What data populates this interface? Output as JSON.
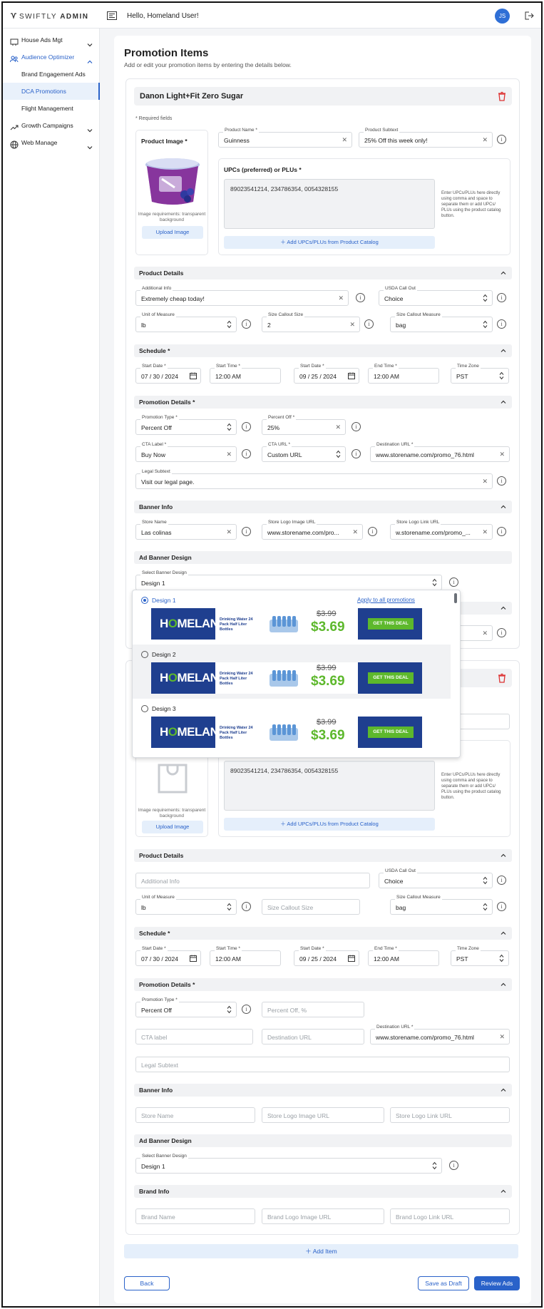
{
  "brand": {
    "name_a": "SWIFTLY",
    "name_b": "ADMIN"
  },
  "header": {
    "greeting": "Hello, Homeland User!",
    "avatar_initials": "JS"
  },
  "sidebar": {
    "items": [
      {
        "label": "House Ads Mgt"
      },
      {
        "label": "Audience Optimizer"
      },
      {
        "label": "Growth Campaigns"
      },
      {
        "label": "Web Manage"
      }
    ],
    "subitems": [
      {
        "label": "Brand Engagement Ads"
      },
      {
        "label": "DCA Promotions"
      },
      {
        "label": "Flight Management"
      }
    ]
  },
  "page": {
    "title": "Promotion Items",
    "subtitle": "Add or edit your promotion items by entering the details below."
  },
  "item1": {
    "title": "Danon Light+Fit Zero Sugar",
    "required_note": "* Required fields",
    "product_image_label": "Product Image *",
    "image_req": "Image requirements: transparent background",
    "upload_label": "Upload Image",
    "product_name": {
      "label": "Product Name *",
      "value": "Guinness"
    },
    "product_subtext": {
      "label": "Product Subtext",
      "value": "25% Off this week only!"
    },
    "upcs": {
      "label": "UPCs (preferred) or PLUs *",
      "value": "89023541214, 234786354, 0054328155",
      "help": "Enter UPCs/PLUs here directly using comma and space to separate them or add UPCs/ PLUs using the product catalog button.",
      "add_label": "Add UPCs/PLUs from Product Catalog"
    },
    "product_details": {
      "title": "Product Details",
      "additional_info": {
        "label": "Additional Info",
        "value": "Extremely cheap today!"
      },
      "usda": {
        "label": "USDA Call Out",
        "value": "Choice"
      },
      "uom": {
        "label": "Unit of Measure",
        "value": "lb"
      },
      "size_callout": {
        "label": "Size Callout Size",
        "value": "2"
      },
      "size_measure": {
        "label": "Size Callout Measure",
        "value": "bag"
      }
    },
    "schedule": {
      "title": "Schedule *",
      "start_date": {
        "label": "Start Date *",
        "value": "07 / 30 / 2024"
      },
      "start_time": {
        "label": "Start Time *",
        "value": "12:00 AM"
      },
      "end_date": {
        "label": "Start Date *",
        "value": "09 / 25 / 2024"
      },
      "end_time": {
        "label": "End Time *",
        "value": "12:00 AM"
      },
      "timezone": {
        "label": "Time Zone",
        "value": "PST"
      }
    },
    "promotion": {
      "title": "Promotion Details *",
      "type": {
        "label": "Promotion Type *",
        "value": "Percent Off"
      },
      "percent": {
        "label": "Percent Off *",
        "value": "25%"
      },
      "cta_label": {
        "label": "CTA Label *",
        "value": "Buy Now"
      },
      "cta_url": {
        "label": "CTA URL *",
        "value": "Custom URL"
      },
      "dest_url": {
        "label": "Destination URL *",
        "value": "www.storename.com/promo_76.html"
      },
      "legal": {
        "label": "Legal Subtext",
        "value": "Visit our legal page."
      }
    },
    "banner": {
      "title": "Banner Info",
      "store_name": {
        "label": "Store Name",
        "value": "Las colinas"
      },
      "logo_url": {
        "label": "Store Logo Image URL",
        "value": "www.storename.com/pro..."
      },
      "link_url": {
        "label": "Store Logo Link URL",
        "value": "w.storename.com/promo_..."
      }
    },
    "ad_design": {
      "title": "Ad Banner Design",
      "select_label": "Select Banner Design",
      "value": "Design 1"
    }
  },
  "dropdown": {
    "apply_all": "Apply to all promotions",
    "options": [
      {
        "label": "Design 1"
      },
      {
        "label": "Design 2"
      },
      {
        "label": "Design 3"
      }
    ],
    "banner": {
      "brand_a": "H",
      "brand_o": "O",
      "brand_b": "MELAND",
      "product": "Drinking Water 24 Pack Half Liter Bottles",
      "old_price": "$3.99",
      "new_price": "$3.69",
      "cta": "GET THIS DEAL"
    }
  },
  "item2": {
    "image_req": "Image requirements: transparent background",
    "upload_label": "Upload Image",
    "upcs": {
      "value": "89023541214, 234786354, 0054328155",
      "help": "Enter UPCs/PLUs here directly using comma and space to separate them or add UPCs/ PLUs using the product catalog button.",
      "add_label": "Add UPCs/PLUs from Product Catalog"
    },
    "product_details": {
      "title": "Product Details",
      "additional_info_ph": "Additional Info",
      "usda": {
        "label": "USDA Call Out",
        "value": "Choice"
      },
      "uom": {
        "label": "Unit of Measure",
        "value": "lb"
      },
      "size_callout_ph": "Size Callout Size",
      "size_measure": {
        "label": "Size Callout Measure",
        "value": "bag"
      }
    },
    "schedule": {
      "title": "Schedule *",
      "start_date": {
        "label": "Start Date *",
        "value": "07 / 30 / 2024"
      },
      "start_time": {
        "label": "Start Time *",
        "value": "12:00 AM"
      },
      "end_date": {
        "label": "Start Date *",
        "value": "09 / 25 / 2024"
      },
      "end_time": {
        "label": "End Time *",
        "value": "12:00 AM"
      },
      "timezone": {
        "label": "Time Zone",
        "value": "PST"
      }
    },
    "promotion": {
      "title": "Promotion Details *",
      "type": {
        "label": "Promotion Type *",
        "value": "Percent Off"
      },
      "percent_ph": "Percent Off, %",
      "cta_label_ph": "CTA label",
      "dest_ph": "Destination URL",
      "dest_url": {
        "label": "Destination URL *",
        "value": "www.storename.com/promo_76.html"
      },
      "legal_ph": "Legal Subtext"
    },
    "banner": {
      "title": "Banner Info",
      "store_ph": "Store Name",
      "logo_ph": "Store Logo Image URL",
      "link_ph": "Store Logo Link URL"
    },
    "ad_design": {
      "title": "Ad Banner Design",
      "select_label": "Select Banner Design",
      "value": "Design 1"
    },
    "brand": {
      "title": "Brand Info",
      "name_ph": "Brand Name",
      "logo_ph": "Brand Logo Image URL",
      "link_ph": "Brand Logo Link URL"
    }
  },
  "footer": {
    "add_item": "Add Item",
    "back": "Back",
    "draft": "Save as Draft",
    "review": "Review Ads"
  },
  "colors": {
    "primary": "#2a62c9",
    "price_green": "#5db82c",
    "banner_blue": "#1f3f8f"
  }
}
